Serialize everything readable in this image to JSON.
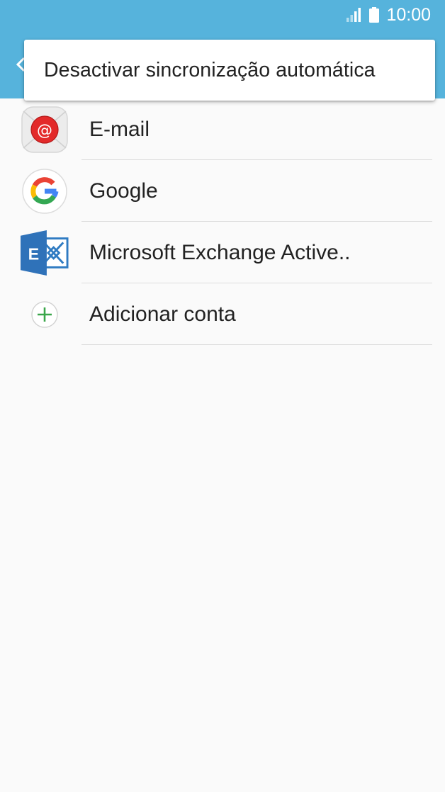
{
  "status_bar": {
    "time": "10:00",
    "signal_icon": "signal-icon",
    "battery_icon": "battery-icon",
    "background": "#56b3dc"
  },
  "app_bar": {
    "back_icon": "back-arrow-icon",
    "background": "#56b3dc"
  },
  "popup_menu": {
    "items": [
      {
        "label": "Desactivar sincronização automática"
      }
    ]
  },
  "accounts": {
    "items": [
      {
        "label": "E-mail",
        "icon": "email-icon"
      },
      {
        "label": "Google",
        "icon": "google-icon"
      },
      {
        "label": "Microsoft Exchange Active..",
        "icon": "exchange-icon"
      },
      {
        "label": "Adicionar conta",
        "icon": "add-icon"
      }
    ]
  }
}
